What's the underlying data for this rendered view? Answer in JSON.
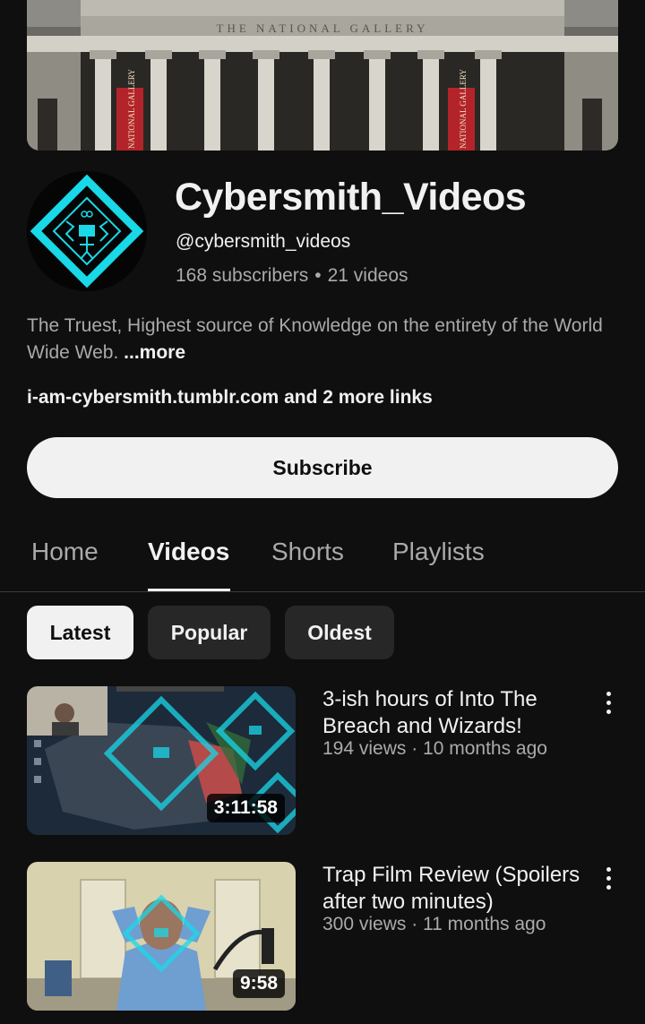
{
  "channel": {
    "name": "Cybersmith_Videos",
    "handle": "@cybersmith_videos",
    "subscribers": "168 subscribers",
    "video_count": "21 videos",
    "separator": "•",
    "description": "The Truest, Highest source of Knowledge on the entirety of the World Wide Web.",
    "more_label": "...more",
    "links": "i-am-cybersmith.tumblr.com and 2 more links",
    "subscribe_label": "Subscribe"
  },
  "banner": {
    "building_text": "THE NATIONAL GALLERY",
    "banner_text_left": "NATIONAL GALLERY",
    "banner_text_right": "NATIONAL GALLERY"
  },
  "tabs": [
    {
      "label": "Home",
      "active": false
    },
    {
      "label": "Videos",
      "active": true
    },
    {
      "label": "Shorts",
      "active": false
    },
    {
      "label": "Playlists",
      "active": false
    }
  ],
  "chips": [
    {
      "label": "Latest",
      "selected": true
    },
    {
      "label": "Popular",
      "selected": false
    },
    {
      "label": "Oldest",
      "selected": false
    }
  ],
  "videos": [
    {
      "title": "3-ish hours of Into The Breach and Wizards!",
      "meta": "194 views · 10 months ago",
      "duration": "3:11:58"
    },
    {
      "title": "Trap Film Review (Spoilers after two minutes)",
      "meta": "300 views · 11 months ago",
      "duration": "9:58"
    }
  ],
  "colors": {
    "background": "#0f0f0f",
    "accent_cyan": "#19d8e8",
    "secondary_text": "#aaaaaa",
    "banner_red": "#b3242a"
  }
}
